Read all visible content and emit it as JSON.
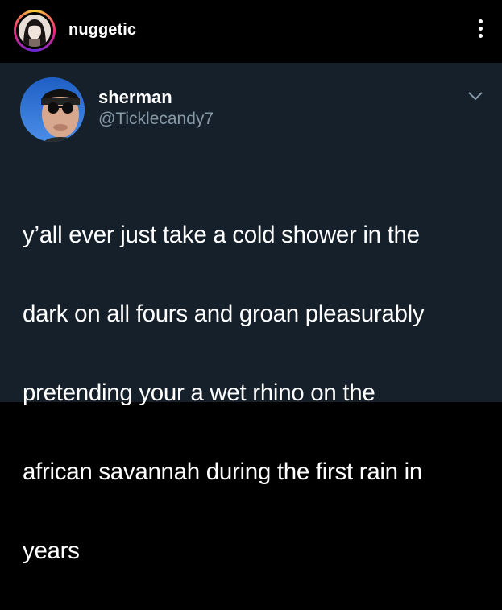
{
  "instagram": {
    "username": "nuggetic"
  },
  "tweet": {
    "display_name": "sherman",
    "handle": "@Ticklecandy7",
    "text_lines": [
      "y’all ever just take a cold shower in the",
      "dark on all fours and groan pleasurably",
      "pretending your a wet rhino on the",
      "african savannah during the first rain in",
      "years"
    ]
  },
  "colors": {
    "ig_background": "#000000",
    "tweet_background": "#15202b",
    "handle_gray": "#8899a6",
    "text_white": "#ffffff"
  },
  "icons": {
    "more": "vertical-ellipsis-icon",
    "tweet_menu": "chevron-down-icon"
  }
}
